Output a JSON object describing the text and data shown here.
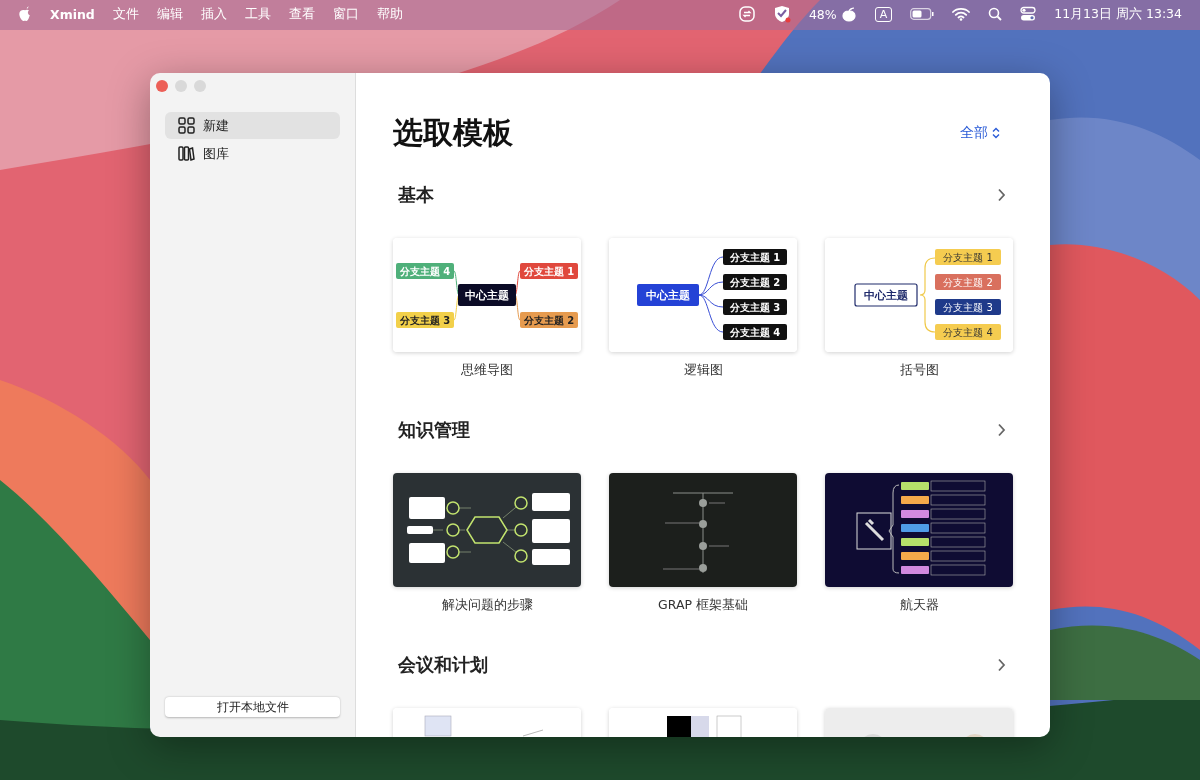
{
  "menu_bar": {
    "app_name": "Xmind",
    "menus": [
      "文件",
      "编辑",
      "插入",
      "工具",
      "查看",
      "窗口",
      "帮助"
    ],
    "battery_percent": "48%",
    "input_source": "A",
    "clock": "11月13日 周六 13:34"
  },
  "sidebar": {
    "items": [
      {
        "label": "新建",
        "selected": true
      },
      {
        "label": "图库",
        "selected": false
      }
    ],
    "open_button": "打开本地文件"
  },
  "main": {
    "title": "选取模板",
    "filter": "全部",
    "sections": [
      {
        "title": "基本",
        "templates": [
          {
            "name": "思维导图",
            "kind": "mindmap",
            "center": "中心主题",
            "branches": [
              {
                "label": "分支主题 4",
                "color": "#4fb07a"
              },
              {
                "label": "分支主题 1",
                "color": "#e0483d"
              },
              {
                "label": "分支主题 3",
                "color": "#f2d04a"
              },
              {
                "label": "分支主题 2",
                "color": "#e69b4f"
              }
            ]
          },
          {
            "name": "逻辑图",
            "kind": "logic",
            "center": "中心主题",
            "branches": [
              {
                "label": "分支主题 1"
              },
              {
                "label": "分支主题 2"
              },
              {
                "label": "分支主题 3"
              },
              {
                "label": "分支主题 4"
              }
            ]
          },
          {
            "name": "括号图",
            "kind": "brace",
            "center": "中心主题",
            "branches": [
              {
                "label": "分支主题 1",
                "color": "#f5cc50"
              },
              {
                "label": "分支主题 2",
                "color": "#d9705e"
              },
              {
                "label": "分支主题 3",
                "color": "#1f3a8a"
              },
              {
                "label": "分支主题 4",
                "color": "#f5cc50"
              }
            ]
          }
        ]
      },
      {
        "title": "知识管理",
        "templates": [
          {
            "name": "解决问题的步骤",
            "kind": "steps"
          },
          {
            "name": "GRAP 框架基础",
            "kind": "timeline"
          },
          {
            "name": "航天器",
            "kind": "spacecraft"
          }
        ]
      },
      {
        "title": "会议和计划",
        "templates": [
          {
            "kind": "table-sketch"
          },
          {
            "kind": "black-table"
          },
          {
            "kind": "gray-photo"
          }
        ]
      }
    ]
  }
}
